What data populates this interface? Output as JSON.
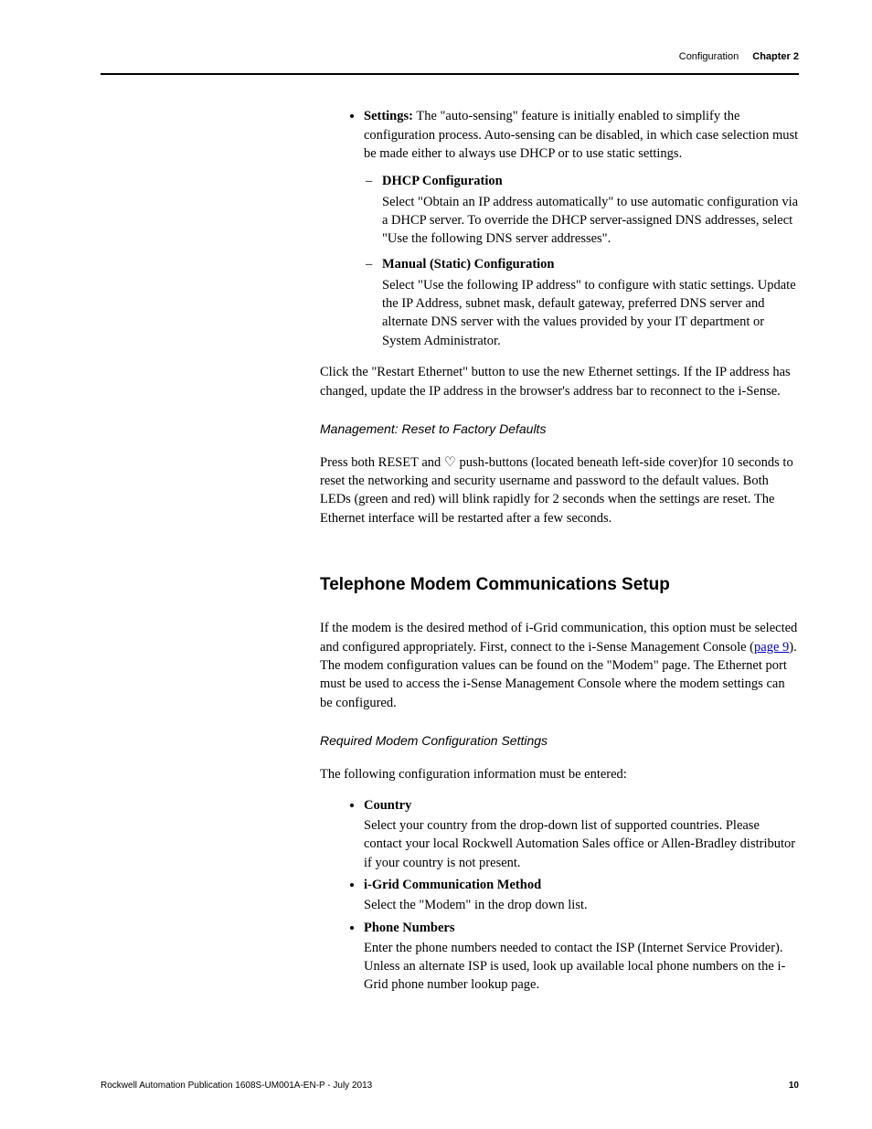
{
  "header": {
    "section": "Configuration",
    "chapter": "Chapter 2"
  },
  "settings_item": {
    "lead_bold": "Settings:",
    "lead_text": " The \"auto-sensing\" feature is initially enabled to simplify the configuration process. Auto-sensing can be disabled, in which case selection must be made either to always use DHCP or to use static settings.",
    "dhcp_title": "DHCP Configuration",
    "dhcp_body": "Select \"Obtain an IP address automatically\" to use automatic configuration via a DHCP server. To override the DHCP server-assigned DNS addresses, select \"Use the following DNS server addresses\".",
    "manual_title": "Manual (Static) Configuration",
    "manual_body": "Select \"Use the following IP address\" to configure with static settings. Update the IP Address, subnet mask, default gateway, preferred DNS server and alternate DNS server with the values provided by your IT department or System Administrator."
  },
  "restart_para": "Click the \"Restart Ethernet\" button to use the new Ethernet settings. If the IP address has changed, update the IP address in the browser's address bar to reconnect to the i-Sense.",
  "reset_heading": "Management: Reset to Factory Defaults",
  "reset_body": "Press both RESET and ♡ push-buttons (located beneath left-side cover)for 10 seconds to reset the networking and security username and password to the default values. Both LEDs (green and red) will blink rapidly for 2 seconds when the settings are reset. The Ethernet interface will be restarted after a few seconds.",
  "modem_heading": "Telephone Modem Communications Setup",
  "modem_intro_pre": "If the modem is the desired method of i-Grid communication, this option must be selected and configured appropriately. First, connect to the i-Sense Management Console (",
  "modem_link": "page 9",
  "modem_intro_post": "). The modem configuration values can be found on the \"Modem\" page. The Ethernet port must be used to access the i-Sense Management Console where the modem settings can be configured.",
  "required_heading": "Required Modem Configuration Settings",
  "required_intro": "The following configuration information must be entered:",
  "country_title": "Country",
  "country_body": "Select your country from the drop-down list of supported countries. Please contact your local Rockwell Automation Sales office or Allen-Bradley distributor if your country is not present.",
  "igrid_title": "i-Grid Communication Method",
  "igrid_body": "Select the \"Modem\" in the drop down list.",
  "phone_title": "Phone Numbers",
  "phone_body": "Enter the phone numbers needed to contact the ISP (Internet Service Provider). Unless an alternate ISP is used, look up available local phone numbers on the i-Grid phone number lookup page.",
  "footer": {
    "pub": "Rockwell Automation Publication 1608S-UM001A-EN-P - July 2013",
    "page": "10"
  }
}
